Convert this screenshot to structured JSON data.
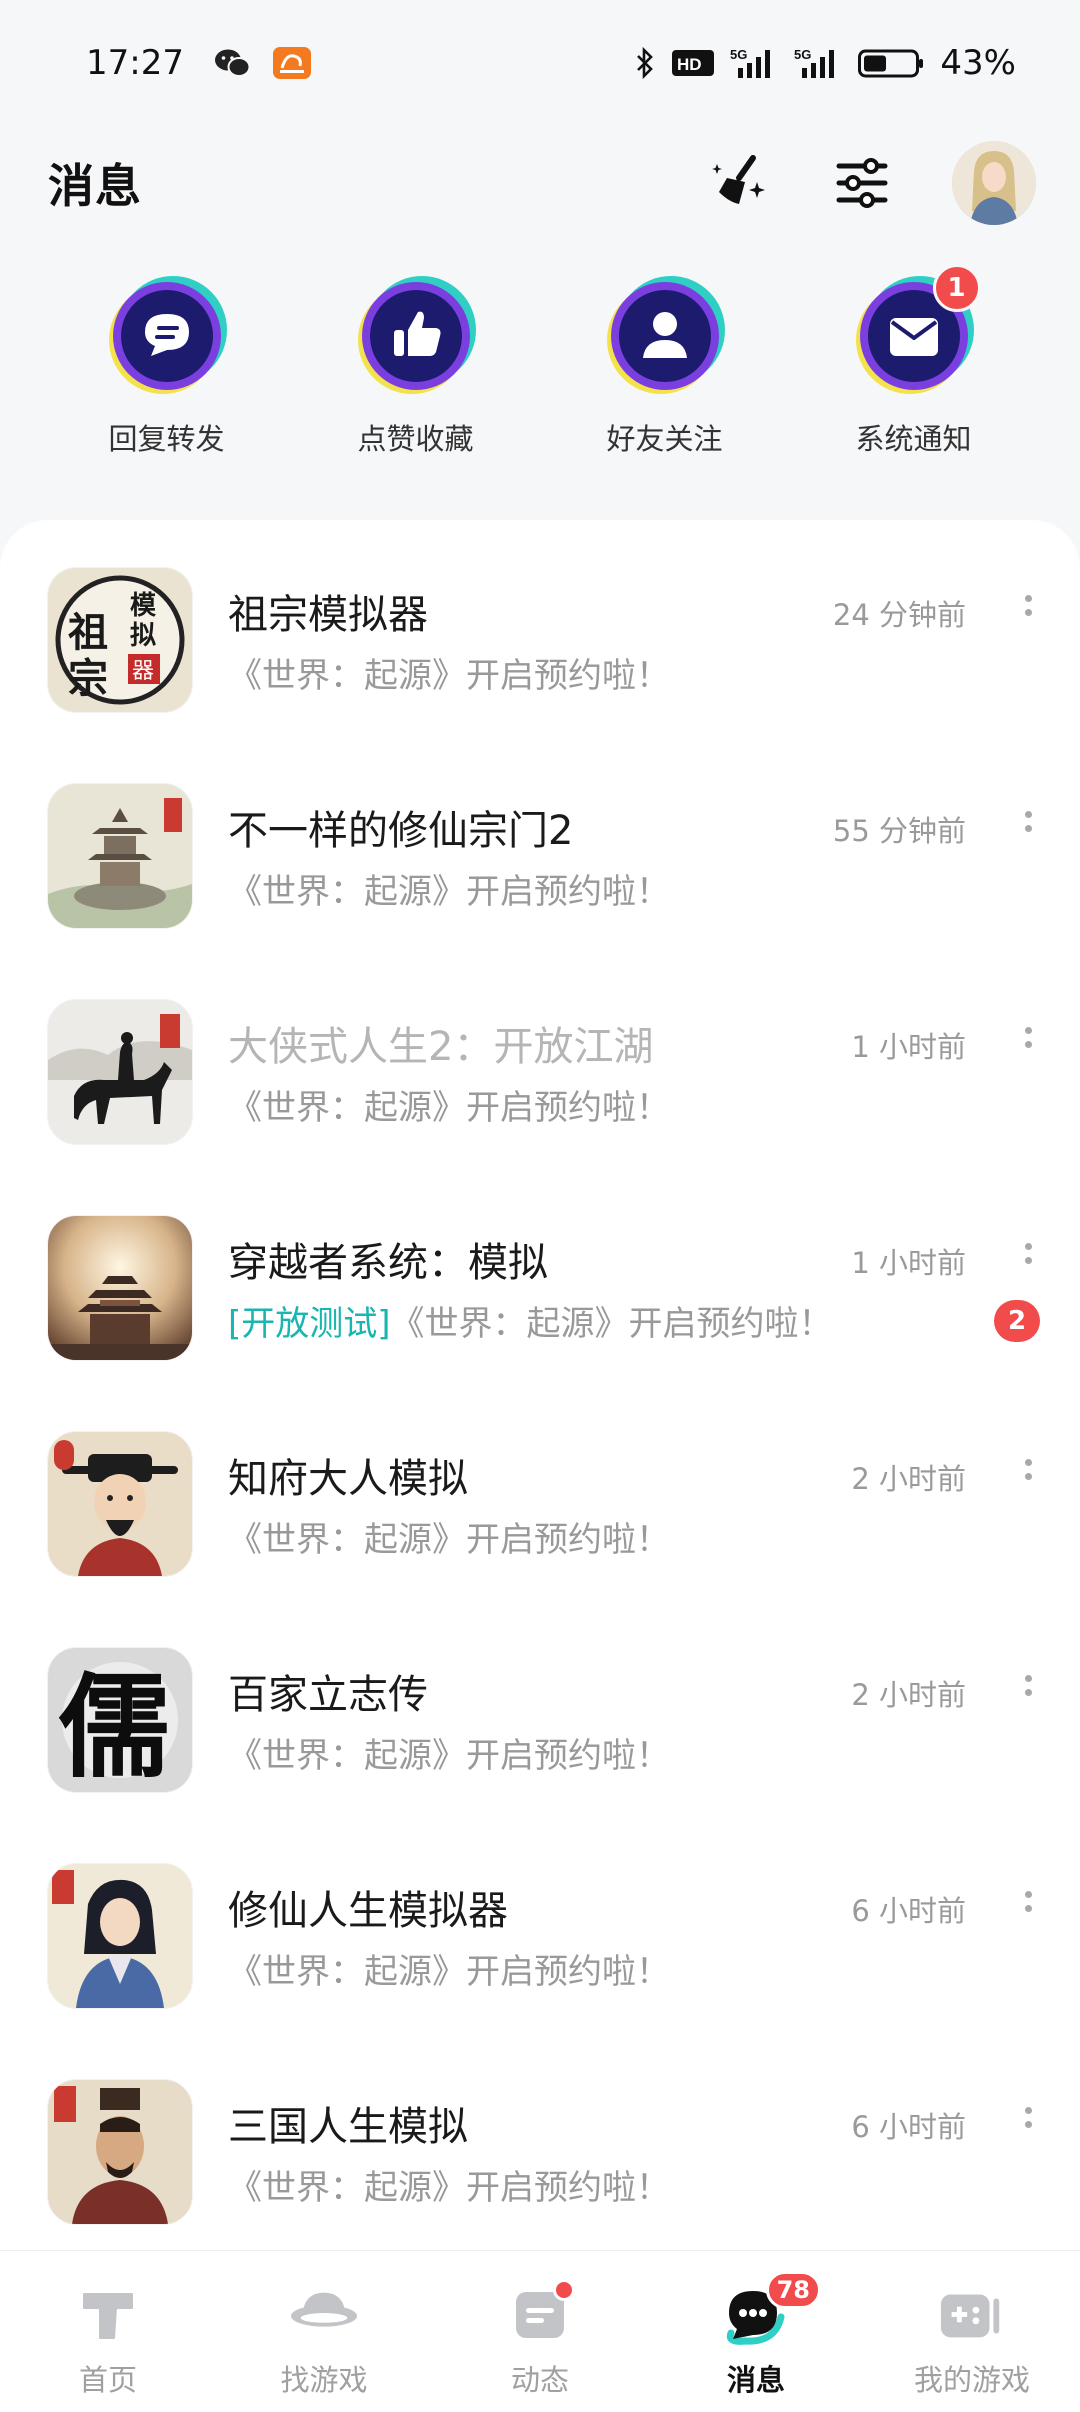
{
  "status_bar": {
    "time": "17:27",
    "battery": "43%",
    "icons": [
      "wechat-icon",
      "app-notification-icon",
      "bluetooth-icon",
      "hd-icon",
      "signal-5g-icon",
      "signal-5g-icon-2",
      "battery-icon"
    ]
  },
  "header": {
    "title": "消息",
    "actions": [
      "clean-icon",
      "filter-icon",
      "avatar"
    ]
  },
  "quick_actions": [
    {
      "label": "回复转发",
      "icon": "chat-bubble-icon"
    },
    {
      "label": "点赞收藏",
      "icon": "thumbs-up-icon"
    },
    {
      "label": "好友关注",
      "icon": "person-icon"
    },
    {
      "label": "系统通知",
      "icon": "envelope-icon",
      "badge": "1"
    }
  ],
  "messages": [
    {
      "title": "祖宗模拟器",
      "preview": "《世界：起源》开启预约啦！",
      "time": "24 分钟前",
      "thumb": "ancestor-sim-icon"
    },
    {
      "title": "不一样的修仙宗门2",
      "preview": "《世界：起源》开启预约啦！",
      "time": "55 分钟前",
      "thumb": "sect-tower-icon"
    },
    {
      "title": "大侠式人生2：开放江湖",
      "preview": "《世界：起源》开启预约啦！",
      "time": "1 小时前",
      "thumb": "rider-icon"
    },
    {
      "title": "穿越者系统：模拟",
      "tag": "[开放测试]",
      "preview": "《世界：起源》开启预约啦！",
      "time": "1 小时前",
      "badge": "2",
      "thumb": "palace-icon"
    },
    {
      "title": "知府大人模拟",
      "preview": "《世界：起源》开启预约啦！",
      "time": "2 小时前",
      "thumb": "magistrate-icon"
    },
    {
      "title": "百家立志传",
      "preview": "《世界：起源》开启预约啦！",
      "time": "2 小时前",
      "thumb": "ru-character-icon"
    },
    {
      "title": "修仙人生模拟器",
      "preview": "《世界：起源》开启预约啦！",
      "time": "6 小时前",
      "thumb": "cultivator-icon"
    },
    {
      "title": "三国人生模拟",
      "preview": "《世界：起源》开启预约啦！",
      "time": "6 小时前",
      "thumb": "three-kingdoms-icon"
    }
  ],
  "bottom_nav": [
    {
      "label": "首页",
      "icon": "home-t-icon"
    },
    {
      "label": "找游戏",
      "icon": "planet-icon"
    },
    {
      "label": "动态",
      "icon": "feed-icon"
    },
    {
      "label": "消息",
      "icon": "message-icon",
      "count": "78",
      "active": true
    },
    {
      "label": "我的游戏",
      "icon": "gamepad-icon"
    }
  ],
  "colors": {
    "accent_teal": "#19b5b0",
    "badge_red": "#f24b4b",
    "quick_circle": "#1d1b6e"
  }
}
